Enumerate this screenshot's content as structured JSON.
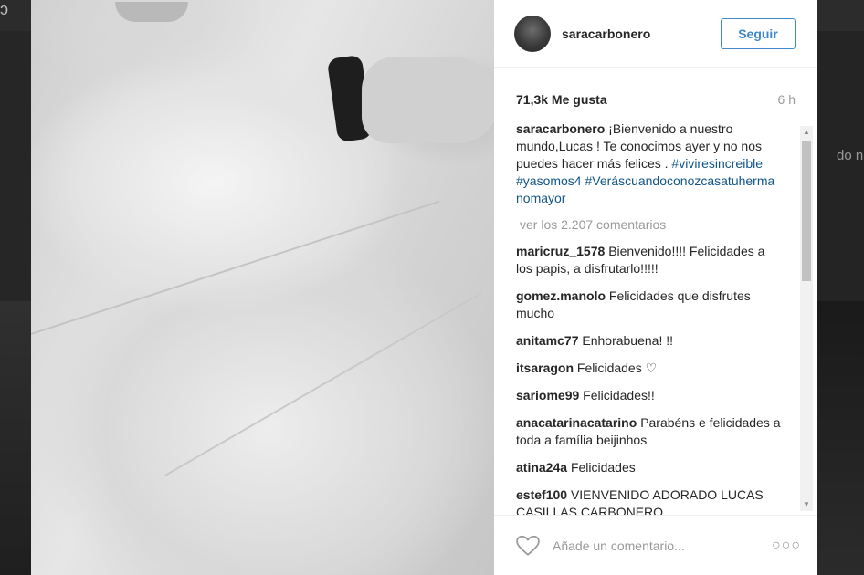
{
  "background": {
    "peek_text": "do nad"
  },
  "post": {
    "username": "saracarbonero",
    "follow_label": "Seguir",
    "likes": "71,3k Me gusta",
    "age": "6 h",
    "caption": {
      "username": "saracarbonero",
      "text": "¡Bienvenido a nuestro mundo,Lucas ! Te conocimos ayer y no nos puedes hacer más felices .",
      "hashtags": [
        "#viviresincreible",
        "#yasomos4",
        "#Veráscuandoconozcasatuhermanomayor"
      ]
    },
    "view_all": "ver los 2.207 comentarios",
    "comments": [
      {
        "user": "maricruz_1578",
        "text": "Bienvenido!!!! Felicidades a los papis, a disfrutarlo!!!!!"
      },
      {
        "user": "gomez.manolo",
        "text": "Felicidades que disfrutes mucho"
      },
      {
        "user": "anitamc77",
        "text": "Enhorabuena! !!"
      },
      {
        "user": "itsaragon",
        "text": "Felicidades ♡"
      },
      {
        "user": "sariome99",
        "text": "Felicidades!!"
      },
      {
        "user": "anacatarinacatarino",
        "text": "Parabéns e felicidades a toda a família beijinhos"
      },
      {
        "user": "atina24a",
        "text": "Felicidades"
      },
      {
        "user": "estef100",
        "text": "VIENVENIDO ADORADO LUCAS CASILLAS CARBONERO"
      }
    ],
    "add_comment_placeholder": "Añade un comentario...",
    "icons": {
      "like": "heart-icon",
      "more": "more-options-icon"
    },
    "colors": {
      "link": "#125688",
      "follow": "#3f89c9"
    }
  }
}
